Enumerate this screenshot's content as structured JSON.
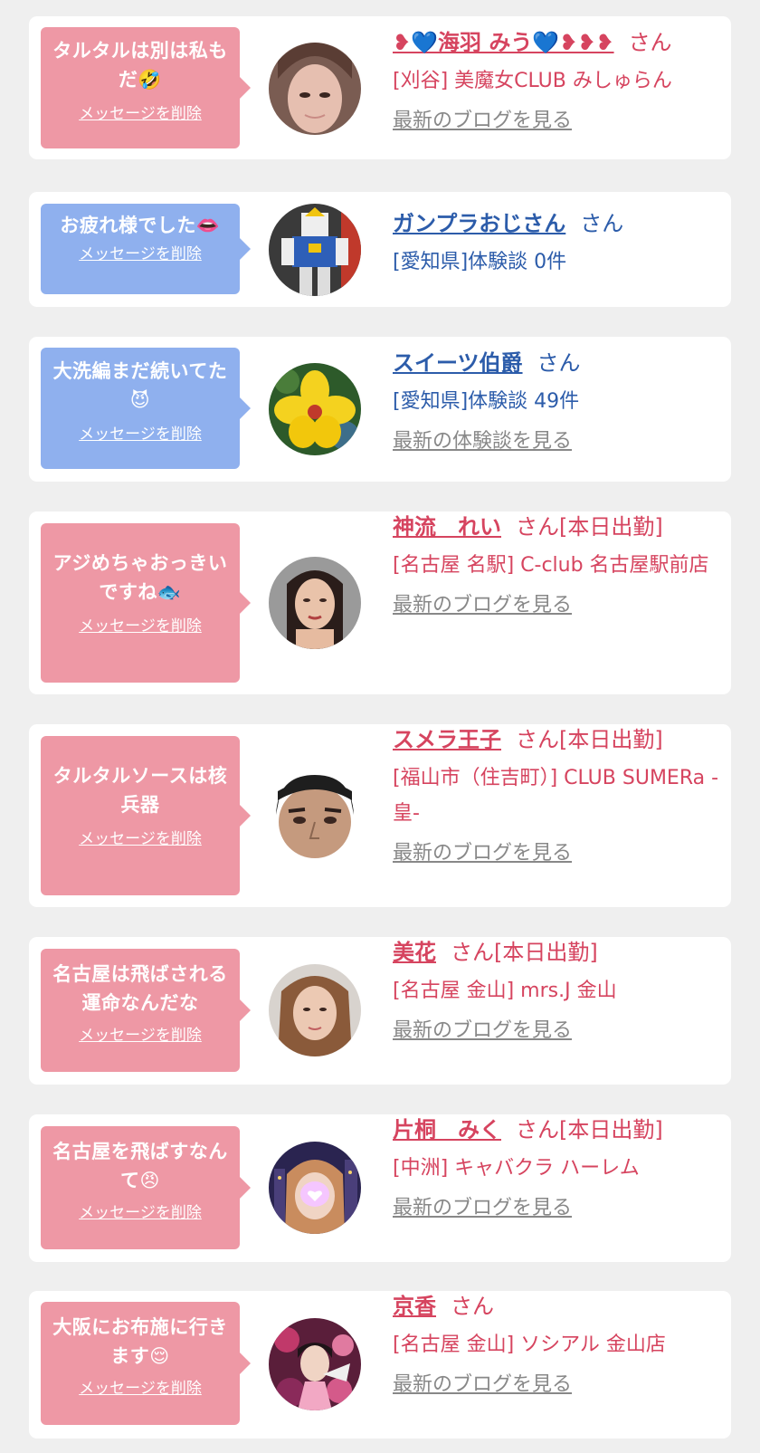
{
  "colors": {
    "bubble_pink": "#ee98a5",
    "bubble_blue": "#8fb0ee",
    "text_pink": "#d6445f",
    "text_blue": "#2c5caa",
    "link_gray": "#888888",
    "background": "#efefef"
  },
  "items": [
    {
      "message": "タルタルは別は私もだ🤣",
      "delete_label": "メッセージを削除",
      "name": "❥💙海羽 みう💙❥❥❥",
      "honorific": "さん",
      "shop": "[刈谷] 美魔女CLUB みしゅらん",
      "link": "最新のブログを見る",
      "theme": "pink",
      "avatar": "woman-face"
    },
    {
      "message": "お疲れ様でした👄",
      "delete_label": "メッセージを削除",
      "name": "ガンプラおじさん",
      "honorific": "さん",
      "shop": "[愛知県]体験談 0件",
      "link": "",
      "theme": "blue",
      "avatar": "gundam-figure"
    },
    {
      "message": "大洗編まだ続いてた😈",
      "delete_label": "メッセージを削除",
      "name": "スイーツ伯爵",
      "honorific": "さん",
      "shop": "[愛知県]体験談 49件",
      "link": "最新の体験談を見る",
      "theme": "blue",
      "avatar": "yellow-flower"
    },
    {
      "message": "アジめちゃおっきいですね🐟",
      "delete_label": "メッセージを削除",
      "name": "神流　れい",
      "honorific": "さん[本日出勤]",
      "shop": "[名古屋 名駅] C-club 名古屋駅前店",
      "link": "最新のブログを見る",
      "theme": "pink",
      "avatar": "woman-portrait"
    },
    {
      "message": "タルタルソースは核兵器",
      "delete_label": "メッセージを削除",
      "name": "スメラ王子",
      "honorific": "さん[本日出勤]",
      "shop": "[福山市（住吉町）] CLUB SUMERa -皇-",
      "link": "最新のブログを見る",
      "theme": "pink",
      "avatar": "man-face"
    },
    {
      "message": "名古屋は飛ばされる運命なんだな",
      "delete_label": "メッセージを削除",
      "name": "美花",
      "honorific": "さん[本日出勤]",
      "shop": "[名古屋 金山] mrs.J 金山",
      "link": "最新のブログを見る",
      "theme": "pink",
      "avatar": "woman-selfie"
    },
    {
      "message": "名古屋を飛ばすなんて😠",
      "delete_label": "メッセージを削除",
      "name": "片桐　みく",
      "honorific": "さん[本日出勤]",
      "shop": "[中洲] キャバクラ ハーレム",
      "link": "最新のブログを見る",
      "theme": "pink",
      "avatar": "woman-night-city"
    },
    {
      "message": "大阪にお布施に行きます😌",
      "delete_label": "メッセージを削除",
      "name": "京香",
      "honorific": "さん",
      "shop": "[名古屋 金山] ソシアル 金山店",
      "link": "最新のブログを見る",
      "theme": "pink",
      "avatar": "woman-kimono"
    }
  ]
}
